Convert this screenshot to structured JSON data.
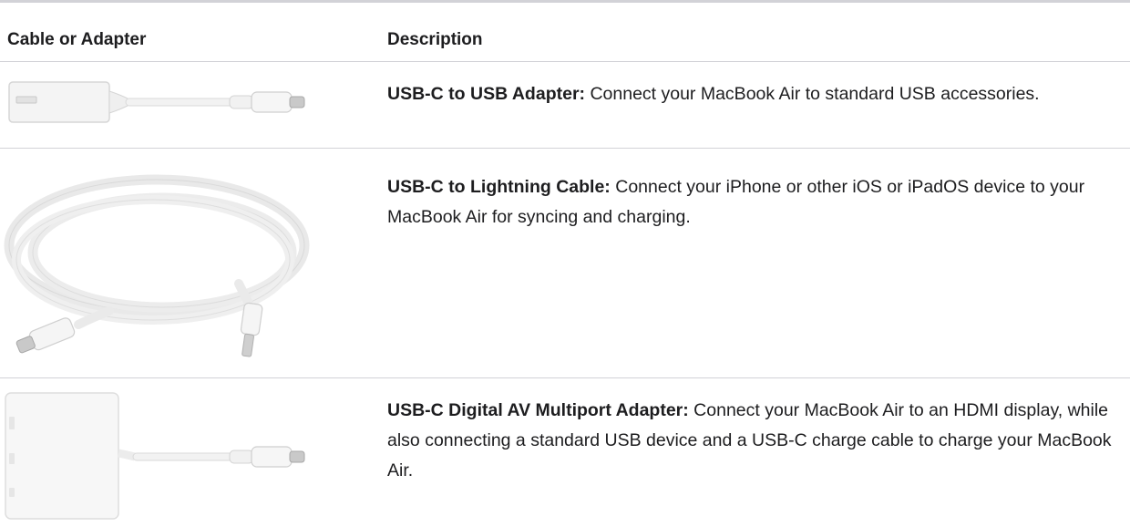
{
  "table": {
    "headers": {
      "col1": "Cable or Adapter",
      "col2": "Description"
    },
    "rows": [
      {
        "name": "USB-C to USB Adapter:",
        "text": " Connect your MacBook Air to standard USB accessories.",
        "image": "usb-c-to-usb-adapter-image"
      },
      {
        "name": "USB-C to Lightning Cable:",
        "text": " Connect your iPhone or other iOS or iPadOS device to your MacBook Air for syncing and charging.",
        "image": "usb-c-to-lightning-cable-image"
      },
      {
        "name": "USB-C Digital AV Multiport Adapter:",
        "text": " Connect your MacBook Air to an HDMI display, while also connecting a standard USB device and a USB-C charge cable to charge your MacBook Air.",
        "image": "usb-c-digital-av-multiport-adapter-image"
      }
    ]
  }
}
